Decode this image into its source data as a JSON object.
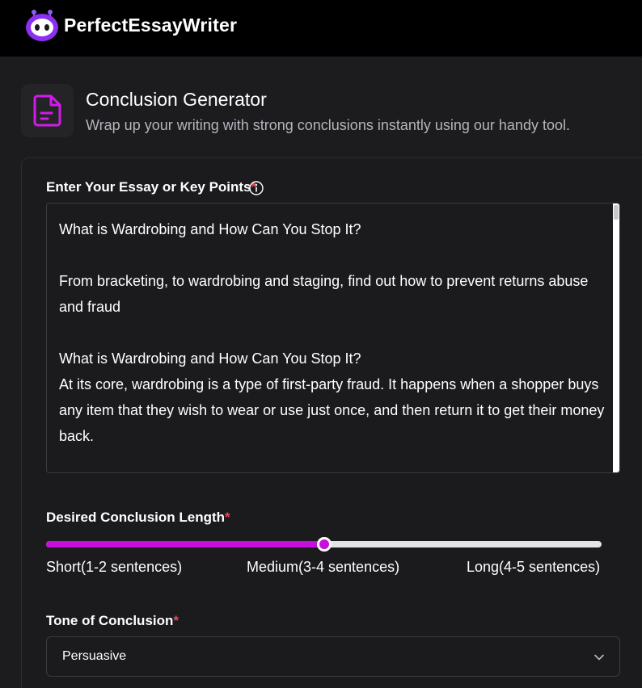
{
  "brand": {
    "name": "PerfectEssayWriter"
  },
  "header": {
    "icon": "document-icon",
    "title": "Conclusion Generator",
    "subtitle": "Wrap up your writing with strong conclusions instantly using our handy tool."
  },
  "essay_input": {
    "label": "Enter Your Essay or Key Points",
    "required_mark": "*",
    "info_icon": "info-icon",
    "paragraphs": [
      "What is Wardrobing and How Can You Stop It?",
      "",
      "From bracketing, to wardrobing and staging, find out how to prevent returns abuse and fraud",
      "",
      "What is Wardrobing and How Can You Stop It?",
      "At its core, wardrobing is a type of first-party fraud. It happens when a shopper buys any item that they wish to wear or use just once, and then return it to get their money back."
    ]
  },
  "length": {
    "label": "Desired Conclusion Length",
    "required_mark": "*",
    "options": [
      "Short(1-2 sentences)",
      "Medium(3-4 sentences)",
      "Long(4-5 sentences)"
    ],
    "selected_index": 1,
    "value_fraction": 0.5
  },
  "tone": {
    "label": "Tone of Conclusion",
    "required_mark": "*",
    "selected": "Persuasive"
  },
  "colors": {
    "accent": "#c60fdc",
    "required": "#e24d5b",
    "background": "#1c1c1f",
    "topbar": "#000000"
  }
}
